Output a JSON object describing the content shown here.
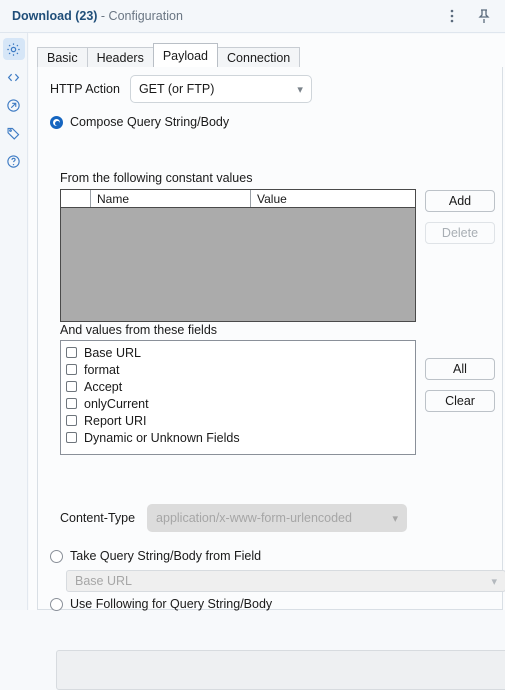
{
  "titlebar": {
    "app_name": "Download",
    "count": "(23)",
    "subtitle": " - Configuration",
    "menu_icon": "kebab-menu-icon",
    "pin_icon": "pin-icon"
  },
  "rail": {
    "items": [
      {
        "icon": "gear-icon",
        "active": true
      },
      {
        "icon": "code-brackets-icon",
        "active": false
      },
      {
        "icon": "arrow-circle-icon",
        "active": false
      },
      {
        "icon": "tag-icon",
        "active": false
      },
      {
        "icon": "help-circle-icon",
        "active": false
      }
    ]
  },
  "tabs": [
    {
      "label": "Basic",
      "active": false
    },
    {
      "label": "Headers",
      "active": false
    },
    {
      "label": "Payload",
      "active": true
    },
    {
      "label": "Connection",
      "active": false
    }
  ],
  "payload": {
    "http_action_label": "HTTP Action",
    "http_action_value": "GET (or FTP)",
    "compose_radio_label": "Compose Query String/Body",
    "compose_radio_selected": true,
    "constants_label": "From the following constant values",
    "table": {
      "columns": [
        "",
        "Name",
        "Value"
      ],
      "rows": []
    },
    "add_button": "Add",
    "delete_button": "Delete",
    "delete_disabled": true,
    "fields_label": "And values from these fields",
    "fields": [
      {
        "label": "Base URL",
        "checked": false
      },
      {
        "label": "format",
        "checked": false
      },
      {
        "label": "Accept",
        "checked": false
      },
      {
        "label": "onlyCurrent",
        "checked": false
      },
      {
        "label": "Report URI",
        "checked": false
      },
      {
        "label": "Dynamic or Unknown Fields",
        "checked": false
      }
    ],
    "all_button": "All",
    "clear_button": "Clear",
    "content_type_label": "Content-Type",
    "content_type_value": "application/x-www-form-urlencoded",
    "content_type_disabled": true,
    "take_from_field_label": "Take Query String/Body from Field",
    "take_from_field_selected": false,
    "take_from_field_value": "Base URL",
    "take_from_field_disabled": true,
    "use_following_label": "Use Following for Query String/Body",
    "use_following_selected": false,
    "use_following_value": ""
  },
  "colors": {
    "accent": "#1565c0",
    "title": "#1f4e79",
    "rail_icon": "#3f7cc4",
    "grid_body": "#ababab"
  }
}
